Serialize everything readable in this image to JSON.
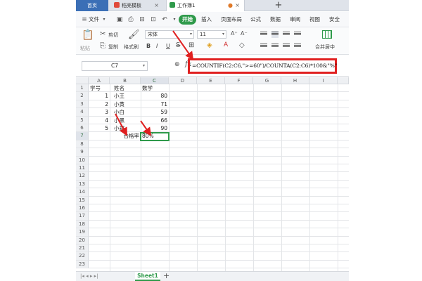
{
  "tabs": {
    "home": "首页",
    "template": "稻壳模板",
    "workbook": "工作簿1",
    "new_tab": "+"
  },
  "menu": {
    "file": "文件",
    "start": "开始",
    "insert": "插入",
    "page_layout": "页面布局",
    "formula": "公式",
    "data": "数据",
    "review": "审阅",
    "view": "视图",
    "security": "安全"
  },
  "ribbon": {
    "paste": "粘贴",
    "cut": "剪切",
    "copy": "复制",
    "format_painter": "格式刷",
    "font_name": "宋体",
    "font_size": "11",
    "bold": "B",
    "italic": "I",
    "underline": "U",
    "merge_center": "合并居中"
  },
  "formula_bar": {
    "name_box": "C7",
    "fx": "fx",
    "formula": "=COUNTIF(C2:C6,\">=60\")/COUNTA(C2:C6)*100&\"%\""
  },
  "columns": [
    "A",
    "B",
    "C",
    "D",
    "E",
    "F",
    "G",
    "H",
    "I"
  ],
  "rows": [
    "1",
    "2",
    "3",
    "4",
    "5",
    "6",
    "7",
    "8",
    "9",
    "10",
    "11",
    "12",
    "13",
    "14",
    "15",
    "16",
    "17",
    "18",
    "19",
    "20",
    "21",
    "22",
    "23"
  ],
  "cells": {
    "a1": "学号",
    "b1": "姓名",
    "c1": "数学",
    "a2": "1",
    "b2": "小王",
    "c2": "80",
    "a3": "2",
    "b3": "小黄",
    "c3": "71",
    "a4": "3",
    "b4": "小白",
    "c4": "59",
    "a5": "4",
    "b5": "小黑",
    "c5": "66",
    "a6": "5",
    "b6": "小郑",
    "c6": "90",
    "b7": "合格率",
    "c7": "80%"
  },
  "sheet": {
    "tab": "Sheet1",
    "add": "+"
  },
  "colors": {
    "accent_green": "#2f9a4b",
    "highlight_red": "#e02020"
  }
}
